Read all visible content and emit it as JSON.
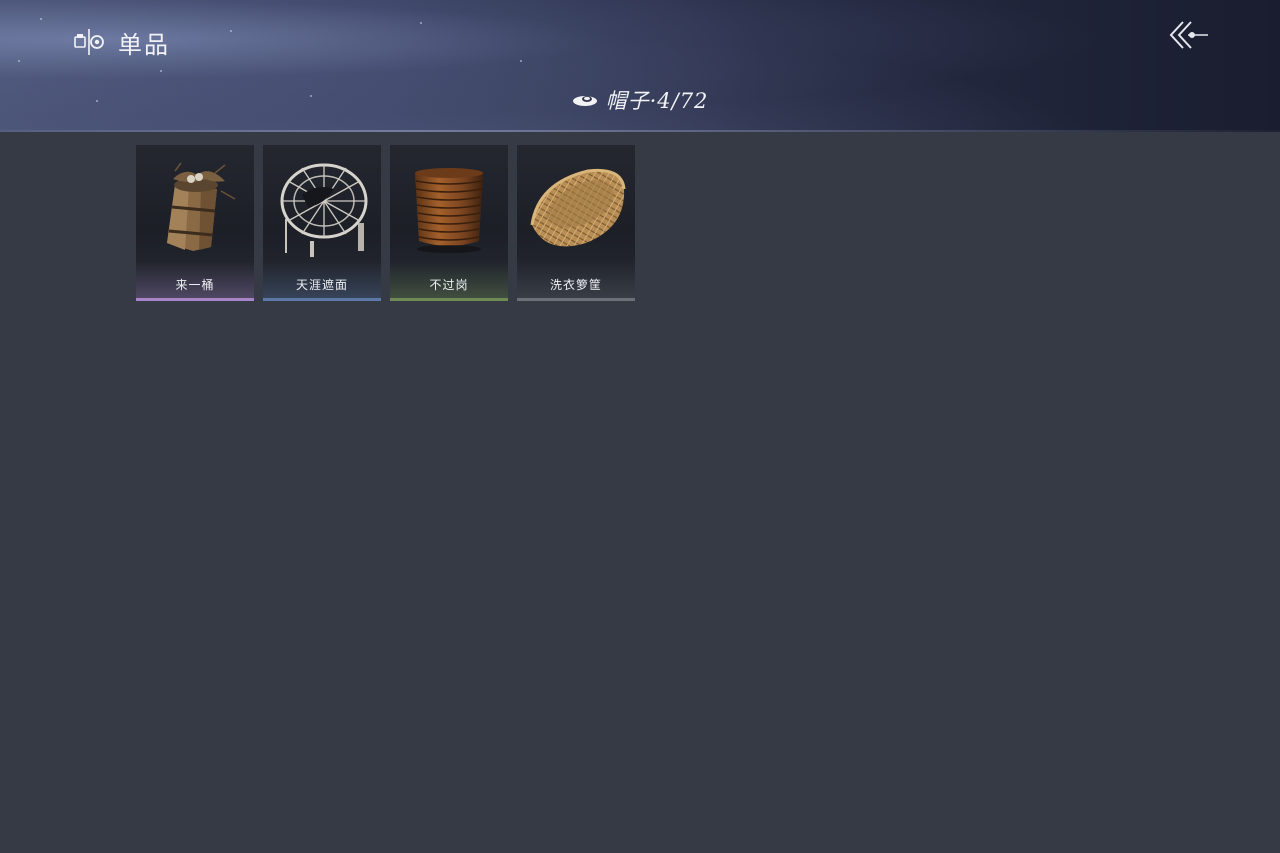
{
  "header": {
    "title": "单品",
    "title_icon": "wardrobe-icon",
    "back_icon": "double-chevron-left-icon"
  },
  "category": {
    "icon": "hat-icon",
    "label": "帽子·4/72"
  },
  "items": [
    {
      "name": "来一桶",
      "icon": "wooden-bucket-icon",
      "rarity_color": "#a785c9"
    },
    {
      "name": "天涯遮面",
      "icon": "bamboo-hat-icon",
      "rarity_color": "#5c78a6"
    },
    {
      "name": "不过岗",
      "icon": "stacked-bowls-icon",
      "rarity_color": "#6f8a55"
    },
    {
      "name": "洗衣箩筐",
      "icon": "wicker-basket-icon",
      "rarity_color": "#6a6f78"
    }
  ]
}
